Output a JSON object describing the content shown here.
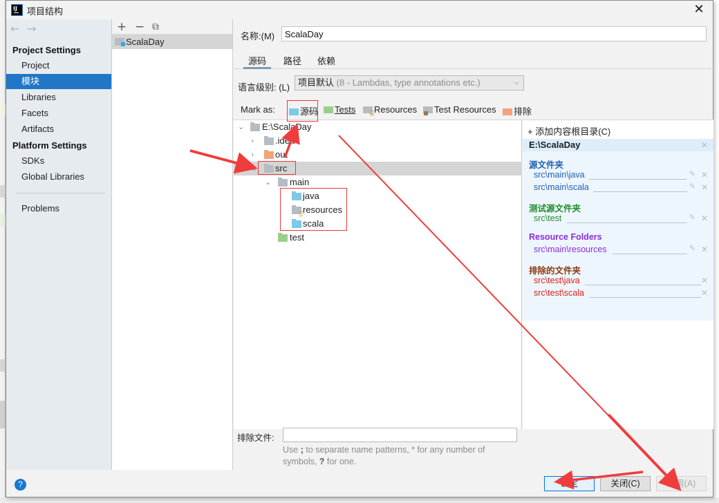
{
  "window": {
    "title": "项目结构",
    "app_icon": "intellij-logo-icon",
    "app_icon_text": "IJ",
    "close_icon": "✕"
  },
  "nav": {
    "back_icon": "←",
    "forward_icon": "→",
    "project_settings_heading": "Project Settings",
    "project_items": [
      {
        "label": "Project",
        "selected": false
      },
      {
        "label": "模块",
        "selected": true
      },
      {
        "label": "Libraries",
        "selected": false
      },
      {
        "label": "Facets",
        "selected": false
      },
      {
        "label": "Artifacts",
        "selected": false
      }
    ],
    "platform_settings_heading": "Platform Settings",
    "platform_items": [
      {
        "label": "SDKs"
      },
      {
        "label": "Global Libraries"
      }
    ],
    "problems_label": "Problems"
  },
  "modules": {
    "toolbar": {
      "add": "+",
      "remove": "−",
      "copy": "⧉"
    },
    "items": [
      {
        "label": "ScalaDay",
        "selected": true
      }
    ]
  },
  "module_settings": {
    "name_label": "名称:(M)",
    "name_value": "ScalaDay",
    "tabs": [
      {
        "label": "源码",
        "active": true
      },
      {
        "label": "路径",
        "active": false
      },
      {
        "label": "依赖",
        "active": false
      }
    ],
    "language_level_label": "语言级别: (L)",
    "language_level_value": "项目默认",
    "language_level_hint": "(8 - Lambdas, type annotations etc.)",
    "mark_as_label": "Mark as:",
    "mark_as_options": [
      {
        "label": "源码",
        "color": "#7ec8e8"
      },
      {
        "label": "Tests",
        "color": "#9bd08a"
      },
      {
        "label": "Resources",
        "color": "#b5bcc4"
      },
      {
        "label": "Test Resources",
        "color": "#b5bcc4"
      },
      {
        "label": "排除",
        "color": "#f2a378"
      }
    ]
  },
  "tree": {
    "rows": [
      {
        "label": "E:\\ScalaDay",
        "expander": "⌄",
        "folder_color": "#b5bcc4",
        "selected": false
      },
      {
        "label": ".idea",
        "expander": "›",
        "folder_color": "#b5bcc4",
        "selected": false
      },
      {
        "label": "out",
        "expander": "›",
        "folder_color": "#f2a378",
        "selected": false
      },
      {
        "label": "src",
        "expander": "⌄",
        "folder_color": "#b5bcc4",
        "selected": true
      },
      {
        "label": "main",
        "expander": "⌄",
        "folder_color": "#b5bcc4",
        "selected": false
      },
      {
        "label": "java",
        "expander": "",
        "folder_color": "#7ec8e8",
        "selected": false
      },
      {
        "label": "resources",
        "expander": "",
        "folder_color": "#b5bcc4",
        "selected": false
      },
      {
        "label": "scala",
        "expander": "",
        "folder_color": "#7ec8e8",
        "selected": false
      },
      {
        "label": "test",
        "expander": "",
        "folder_color": "#9bd08a",
        "selected": false
      }
    ]
  },
  "content_roots": {
    "add_label": "+ 添加内容根目录(C)",
    "root_path": "E:\\ScalaDay",
    "groups": [
      {
        "title": "源文件夹",
        "color": "#1f5fb5",
        "items": [
          "src\\main\\java",
          "src\\main\\scala"
        ],
        "editable": true
      },
      {
        "title": "测试源文件夹",
        "color": "#1f8f2b",
        "items": [
          "src\\test"
        ],
        "editable": true
      },
      {
        "title": "Resource Folders",
        "color": "#8a2be2",
        "items": [
          "src\\main\\resources"
        ],
        "editable": true
      },
      {
        "title": "排除的文件夹",
        "color": "#8b3a0f",
        "item_color": "#e0201b",
        "items": [
          "src\\test\\java",
          "src\\test\\scala"
        ],
        "editable": false
      }
    ]
  },
  "exclude_files": {
    "label": "排除文件:",
    "value": "",
    "help_prefix": "Use ",
    "help_sep": ";",
    "help_mid": " to separate name patterns, * for any number of symbols, ",
    "help_q": "?",
    "help_suffix": " for one."
  },
  "footer": {
    "help_icon": "?",
    "ok_label": "确定",
    "close_label": "关闭(C)",
    "apply_label": "应用(A)",
    "apply_enabled": false
  }
}
